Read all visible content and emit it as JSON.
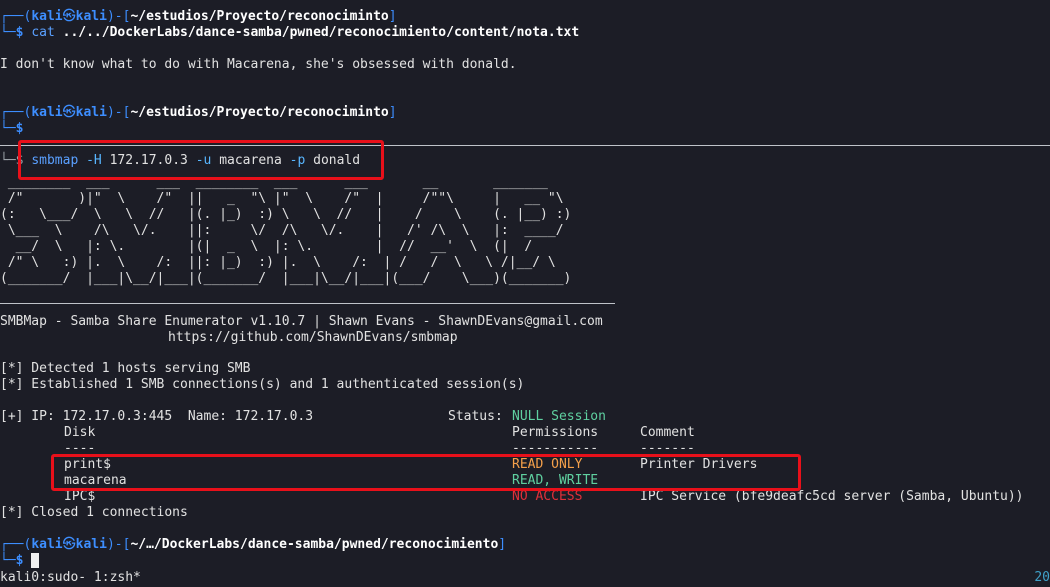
{
  "prompt": {
    "user": "kali",
    "at_symbol": "㉿",
    "host": "kali",
    "corner_top": "┌──",
    "corner_bottom": "└─",
    "dollar": "$",
    "open_paren": "(",
    "close_paren": ")",
    "dash": "-",
    "open_bracket": "[",
    "close_bracket": "]"
  },
  "blocks": [
    {
      "path": "~/estudios/Proyecto/reconocimintο",
      "command": "cat",
      "args": "../../DockerLabs/dance-samba/pwned/reconocimiento/content/nota.txt"
    },
    {
      "path": "~/estudios/Proyecto/reconocimintο"
    },
    {
      "path": "~/…/DockerLabs/dance-samba/pwned/reconocimiento"
    }
  ],
  "nota_output": "I don't know what to do with Macarena, she's obsessed with donald.",
  "smbmap_cmd": {
    "bin": "smbmap",
    "flag_h": "-H",
    "host": "172.17.0.3",
    "flag_u": "-u",
    "user": "macarena",
    "flag_p": "-p",
    "password": "donald"
  },
  "banner": " ________  ___      ___  ________  ___      ___       __       _______\n /\"       )|\"  \\    /\"  ||   _  \"\\ |\"  \\    /\"  |     /\"\"\\     |   __ \"\\\n(:   \\___/  \\   \\  //   |(. |_)  :) \\   \\  //   |    /    \\    (. |__) :)\n \\___  \\    /\\   \\/.    ||:     \\/  /\\   \\/.    |   /' /\\  \\   |:  ____/\n  __/  \\   |: \\.        |(|  _  \\  |: \\.        |  //  __'  \\  (|  /\n /\" \\   :) |.  \\    /:  ||: |_)  :) |.  \\    /:  | /   /  \\   \\ /|__/ \\\n(_______/  |___|\\__/|___|(_______/  |___|\\__/|___|(___/    \\___)(_______)",
  "smbmap_header": {
    "title": "SMBMap - Samba Share Enumerator v1.10.7 | Shawn Evans - ShawnDEvans@gmail.com",
    "url": "https://github.com/ShawnDEvans/smbmap"
  },
  "info_lines": [
    "[*] Detected 1 hosts serving SMB",
    "[*] Established 1 SMB connections(s) and 1 authenticated session(s)"
  ],
  "host_line": {
    "prefix": "[+] IP: 172.17.0.3:445  Name: 172.17.0.3",
    "status_label": "Status:",
    "status_value": "NULL Session"
  },
  "table": {
    "headers": [
      "Disk",
      "Permissions",
      "Comment"
    ],
    "underline": [
      "----",
      "-----------",
      "-------"
    ],
    "rows": [
      {
        "disk": "print$",
        "perm": "READ ONLY",
        "comment": "Printer Drivers",
        "perm_color": "#f5a04a"
      },
      {
        "disk": "macarena",
        "perm": "READ, WRITE",
        "comment": "",
        "perm_color": "#5fd0a0"
      },
      {
        "disk": "IPC$",
        "perm": "NO ACCESS",
        "comment": "IPC Service (bfe9deafc5cd server (Samba, Ubuntu))",
        "perm_color": "#e0303a"
      }
    ]
  },
  "closed_line": "[*] Closed 1 connections",
  "statusbar": {
    "left": "kali0:sudo- 1:zsh*",
    "right": "20"
  }
}
